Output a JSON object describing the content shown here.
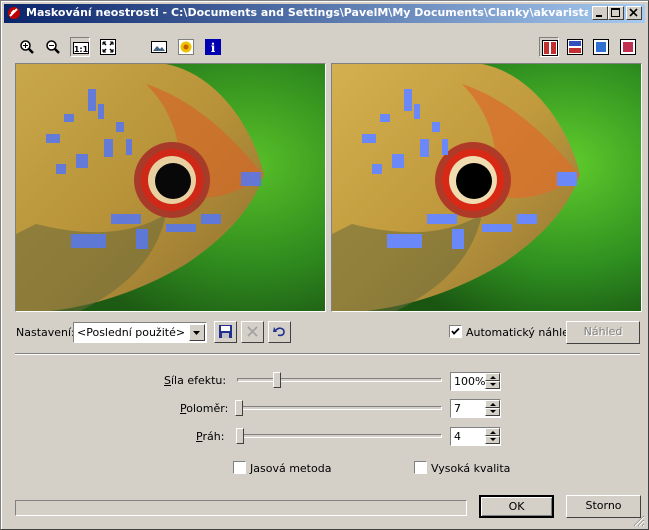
{
  "window": {
    "title": "Maskování neostrosti - C:\\Documents and Settings\\PavelM\\My Documents\\Clanky\\akvarista.cz\\x..."
  },
  "toolbar": {
    "left_tools": [
      "zoom-in-icon",
      "zoom-out-icon",
      "actual-size-icon",
      "fit-to-window-icon",
      "image-icon",
      "flower-icon",
      "info-icon"
    ],
    "actual_size_label": "1:1",
    "info_label": "i",
    "right_tools": [
      "split-vertical-icon",
      "split-horizontal-icon",
      "original-only-icon",
      "result-only-icon"
    ]
  },
  "settings": {
    "label": "Nastavení:",
    "preset_value": "<Poslední použité>",
    "auto_preview_label": "Automatický náhled",
    "auto_preview_checked": true,
    "preview_button": "Náhled"
  },
  "params": {
    "strength": {
      "label": "Síla efektu:",
      "value": "100%",
      "level": 0.2
    },
    "radius": {
      "label": "Poloměr:",
      "value": "7",
      "level": 0.0
    },
    "threshold": {
      "label": "Práh:",
      "value": "4",
      "level": 0.01
    }
  },
  "options": {
    "luminance_label": "Jasová metoda",
    "luminance_checked": false,
    "high_quality_label": "Vysoká kvalita",
    "high_quality_checked": false
  },
  "buttons": {
    "ok": "OK",
    "cancel": "Storno"
  },
  "colors": {
    "title_start": "#0a246a",
    "title_end": "#a6caf0",
    "face": "#d4d0c8"
  }
}
